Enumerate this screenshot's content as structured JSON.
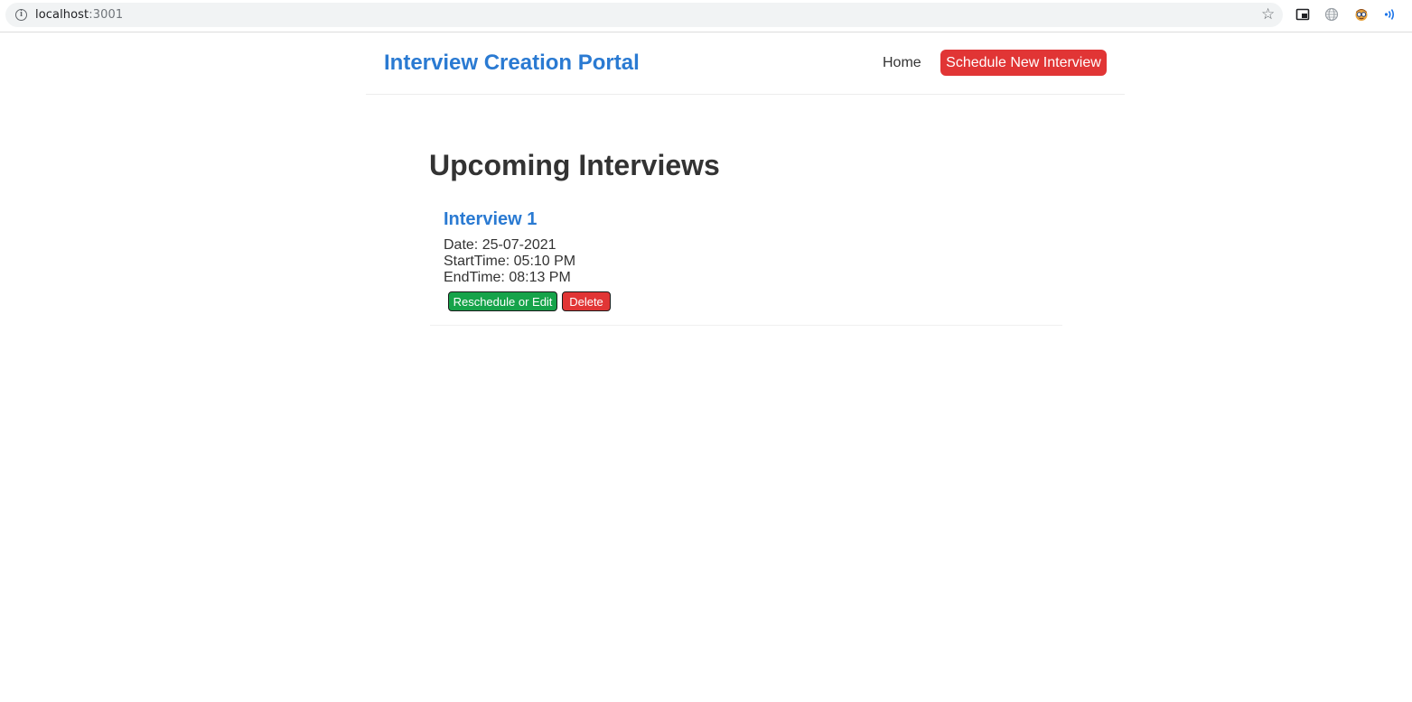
{
  "browser": {
    "url_host": "localhost",
    "url_port": ":3001",
    "icons": [
      "info-icon",
      "star-icon",
      "picture-in-picture-icon",
      "globe-icon",
      "extension-face-icon",
      "cast-icon"
    ]
  },
  "header": {
    "brand": "Interview Creation Portal",
    "nav": {
      "home_label": "Home",
      "schedule_label": "Schedule New Interview"
    }
  },
  "main": {
    "title": "Upcoming Interviews",
    "interviews": [
      {
        "title": "Interview 1",
        "date": "Date: 25-07-2021",
        "start": "StartTime: 05:10 PM",
        "end": "EndTime: 08:13 PM",
        "edit_label": "Reschedule or Edit",
        "delete_label": "Delete"
      }
    ]
  },
  "colors": {
    "brand_blue": "#2a7ad2",
    "danger_red": "#e13535",
    "success_green": "#16a34a",
    "text_dark": "#333333"
  }
}
